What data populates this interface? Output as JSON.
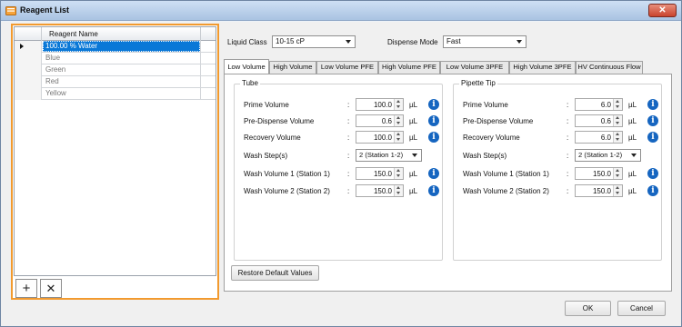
{
  "window": {
    "title": "Reagent List",
    "close_label": "✕"
  },
  "grid": {
    "column_header": "Reagent Name",
    "rows": [
      "100.00 % Water",
      "Blue",
      "Green",
      "Red",
      "Yellow"
    ],
    "selected_index": 0
  },
  "grid_buttons": {
    "add": "+",
    "remove": "✕"
  },
  "liquid_class": {
    "label": "Liquid Class",
    "value": "10-15 cP"
  },
  "dispense_mode": {
    "label": "Dispense Mode",
    "value": "Fast"
  },
  "tabs": [
    "Low Volume",
    "High Volume",
    "Low Volume PFE",
    "High Volume PFE",
    "Low Volume 3PFE",
    "High Volume 3PFE",
    "HV Continuous Flow"
  ],
  "active_tab": 0,
  "tube": {
    "title": "Tube",
    "fields": [
      {
        "label": "Prime Volume",
        "value": "100.0",
        "unit": "µL",
        "info": true
      },
      {
        "label": "Pre-Dispense Volume",
        "value": "0.6",
        "unit": "µL",
        "info": true
      },
      {
        "label": "Recovery Volume",
        "value": "100.0",
        "unit": "µL",
        "info": true
      },
      {
        "label": "Wash Step(s)",
        "select": "2 (Station 1-2)"
      },
      {
        "label": "Wash Volume 1 (Station 1)",
        "value": "150.0",
        "unit": "µL",
        "info": true
      },
      {
        "label": "Wash Volume 2 (Station 2)",
        "value": "150.0",
        "unit": "µL",
        "info": true
      }
    ]
  },
  "pipette_tip": {
    "title": "Pipette Tip",
    "fields": [
      {
        "label": "Prime Volume",
        "value": "6.0",
        "unit": "µL",
        "info": true
      },
      {
        "label": "Pre-Dispense Volume",
        "value": "0.6",
        "unit": "µL",
        "info": true
      },
      {
        "label": "Recovery Volume",
        "value": "6.0",
        "unit": "µL",
        "info": true
      },
      {
        "label": "Wash Step(s)",
        "select": "2 (Station 1-2)"
      },
      {
        "label": "Wash Volume 1 (Station 1)",
        "value": "150.0",
        "unit": "µL",
        "info": true
      },
      {
        "label": "Wash Volume 2 (Station 2)",
        "value": "150.0",
        "unit": "µL",
        "info": true
      }
    ]
  },
  "colon": ":",
  "info_glyph": "i",
  "restore_button": "Restore Default Values",
  "ok_button": "OK",
  "cancel_button": "Cancel",
  "colors": {
    "selection": "#0a78d7",
    "panel_border": "#f29a2e",
    "info": "#1565c0"
  },
  "icons": {
    "app": "reagent-list-icon",
    "close": "close-icon",
    "add": "plus-icon",
    "remove": "x-icon",
    "info": "info-icon",
    "dropdown": "chevron-down-icon"
  }
}
